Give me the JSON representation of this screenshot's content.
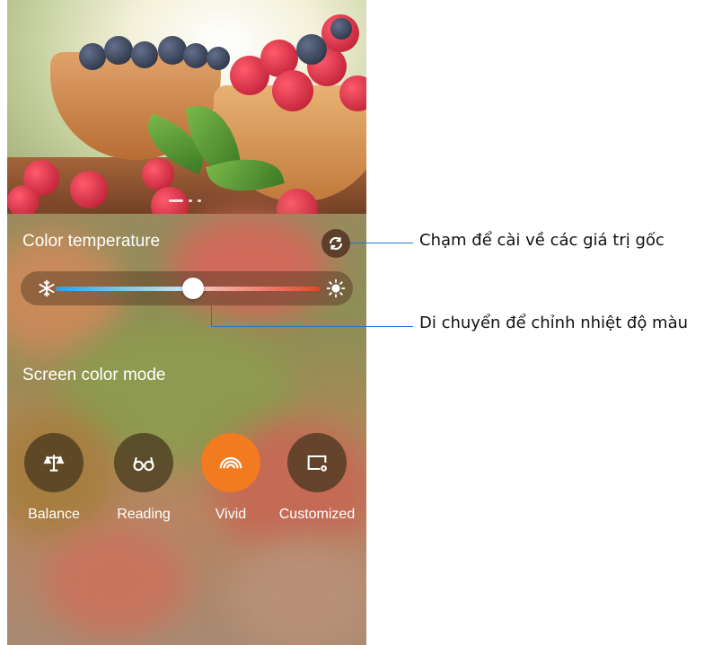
{
  "color_temperature": {
    "title": "Color temperature",
    "value_fraction": 0.52
  },
  "screen_color_mode": {
    "title": "Screen color mode",
    "modes": [
      {
        "label": "Balance",
        "icon": "balance-scale-icon",
        "active": false
      },
      {
        "label": "Reading",
        "icon": "glasses-icon",
        "active": false
      },
      {
        "label": "Vivid",
        "icon": "vivid-arcs-icon",
        "active": true
      },
      {
        "label": "Customized",
        "icon": "customize-screen-icon",
        "active": false
      }
    ]
  },
  "annotations": {
    "reset": "Chạm để cài về các giá trị gốc",
    "slider": "Di chuyển để chỉnh nhiệt độ màu"
  },
  "colors": {
    "accent": "#f27a1f",
    "callout_line": "#2a6fd1"
  }
}
